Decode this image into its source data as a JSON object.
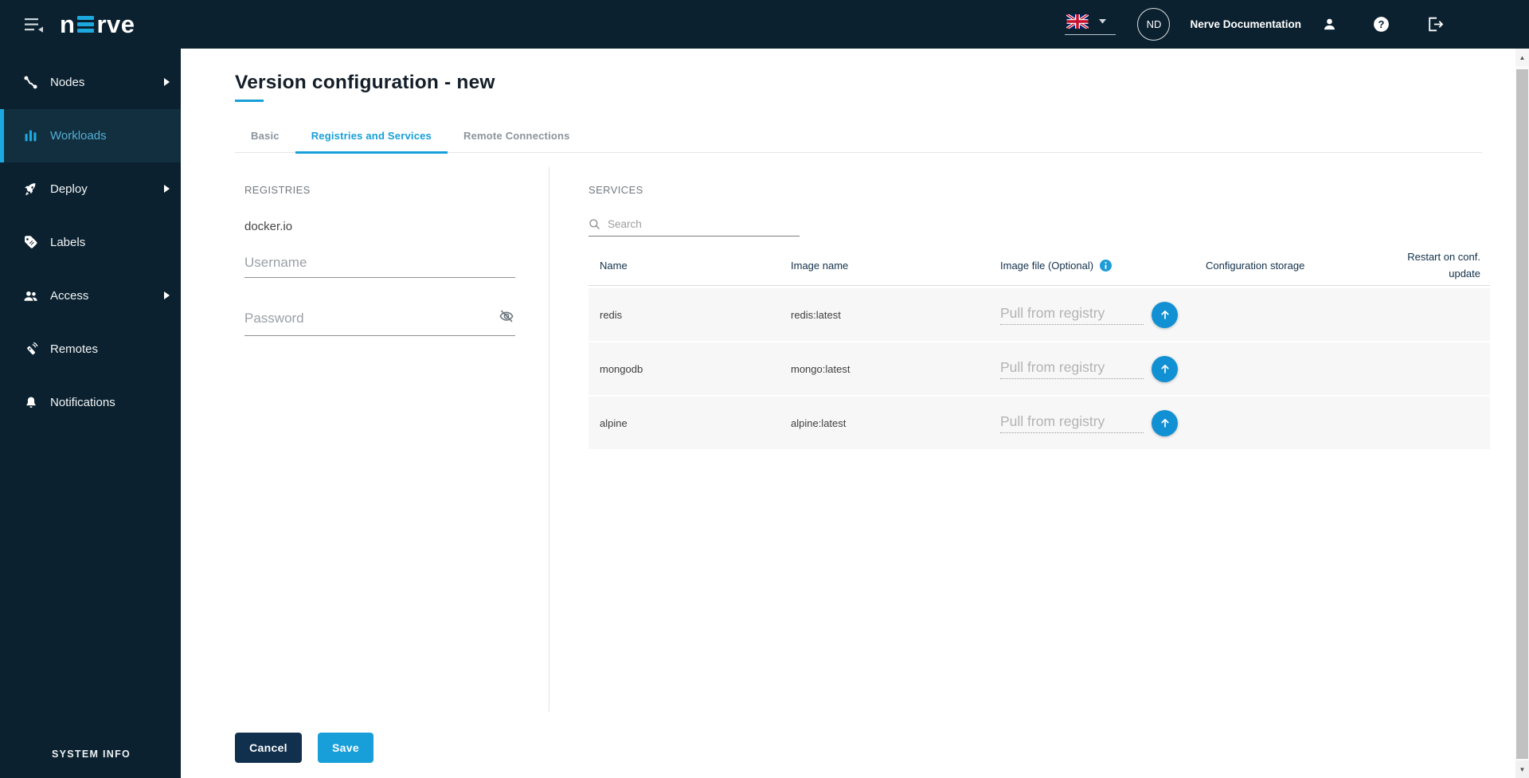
{
  "topbar": {
    "logo_prefix": "n",
    "logo_suffix": "rve",
    "avatar_initials": "ND",
    "user_name": "Nerve Documentation"
  },
  "sidebar": {
    "items": [
      {
        "label": "Nodes",
        "has_submenu": true,
        "active": false
      },
      {
        "label": "Workloads",
        "has_submenu": false,
        "active": true
      },
      {
        "label": "Deploy",
        "has_submenu": true,
        "active": false
      },
      {
        "label": "Labels",
        "has_submenu": false,
        "active": false
      },
      {
        "label": "Access",
        "has_submenu": true,
        "active": false
      },
      {
        "label": "Remotes",
        "has_submenu": false,
        "active": false
      },
      {
        "label": "Notifications",
        "has_submenu": false,
        "active": false
      }
    ],
    "system_info": "SYSTEM INFO"
  },
  "page": {
    "title": "Version configuration - new",
    "tabs": [
      {
        "label": "Basic",
        "active": false
      },
      {
        "label": "Registries and Services",
        "active": true
      },
      {
        "label": "Remote Connections",
        "active": false
      }
    ]
  },
  "registries": {
    "section_label": "REGISTRIES",
    "registry_name": "docker.io",
    "username_placeholder": "Username",
    "password_placeholder": "Password"
  },
  "services": {
    "section_label": "SERVICES",
    "search_placeholder": "Search",
    "table": {
      "headers": [
        "Name",
        "Image name",
        "Image file (Optional)",
        "Configuration storage",
        "Restart on conf. update"
      ],
      "rows": [
        {
          "name": "redis",
          "image_name": "redis:latest",
          "image_file_placeholder": "Pull from registry"
        },
        {
          "name": "mongodb",
          "image_name": "mongo:latest",
          "image_file_placeholder": "Pull from registry"
        },
        {
          "name": "alpine",
          "image_name": "alpine:latest",
          "image_file_placeholder": "Pull from registry"
        }
      ]
    }
  },
  "footer": {
    "cancel_label": "Cancel",
    "save_label": "Save"
  },
  "colors": {
    "accent": "#189fd9",
    "topbar_bg": "#0b212f",
    "active_item_bg": "#112f3e",
    "active_item_text": "#55aed6",
    "row_bg": "#f7f7f7",
    "upload_button": "#1190d3",
    "cancel_button": "#11304d"
  }
}
